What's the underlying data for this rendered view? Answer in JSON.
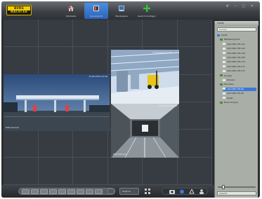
{
  "app": {
    "logo_line1": "BURG",
    "logo_line2": "WÄCHTER"
  },
  "toolbar": {
    "buttons": [
      {
        "label": "Startseite",
        "icon": "home-icon"
      },
      {
        "label": "Live-Ansicht",
        "icon": "live-view-icon",
        "active": true
      },
      {
        "label": "Wiedergabe",
        "icon": "playback-icon"
      },
      {
        "label": "Gerät hinzufügen",
        "icon": "add-icon"
      }
    ],
    "window_controls": "⚙ ‒ ▢ ✕"
  },
  "cameras": [
    {
      "name": "DVR Kamera",
      "timestamp": "15.09.2015 22:30"
    },
    {
      "name": "",
      "timestamp": "15.09.2015 22:30"
    },
    {
      "name": "DVR Kamera",
      "timestamp": "15.09.2015 22:30"
    }
  ],
  "panel": {
    "title": "Gerät",
    "search_placeholder": "Suchen",
    "tree": [
      {
        "label": "Gerät",
        "level": 0
      },
      {
        "label": "Netzwerkgerät",
        "level": 1
      },
      {
        "label": "192.168.178.121",
        "level": 2
      },
      {
        "label": "192.168.178.122",
        "level": 2
      },
      {
        "label": "192.168.178.150",
        "level": 2
      },
      {
        "label": "192.168.178.165",
        "level": 2
      },
      {
        "label": "192.168.178.170",
        "level": 2
      },
      {
        "label": "192.168.178.171",
        "level": 2
      },
      {
        "label": "192.168.178.172",
        "level": 2
      },
      {
        "label": "Gruppe",
        "level": 1
      },
      {
        "label": "Kamera",
        "level": 2
      },
      {
        "label": "Favoriten",
        "level": 1
      },
      {
        "label": "192.168.178.90",
        "level": 2,
        "selected": true
      },
      {
        "label": "192.168.178.95",
        "level": 2
      },
      {
        "label": "Gerät",
        "level": 2
      },
      {
        "label": "Neue Gruppe",
        "level": 1
      }
    ],
    "footer_label": "Ansicht"
  },
  "bottombar": {
    "stream_select": "Original"
  },
  "colors": {
    "accent": "#2a63b8",
    "brand_yellow": "#f2cc00",
    "add_green": "#35c435",
    "panel_bg": "#a9aea7",
    "grid_bg": "#373b42"
  }
}
